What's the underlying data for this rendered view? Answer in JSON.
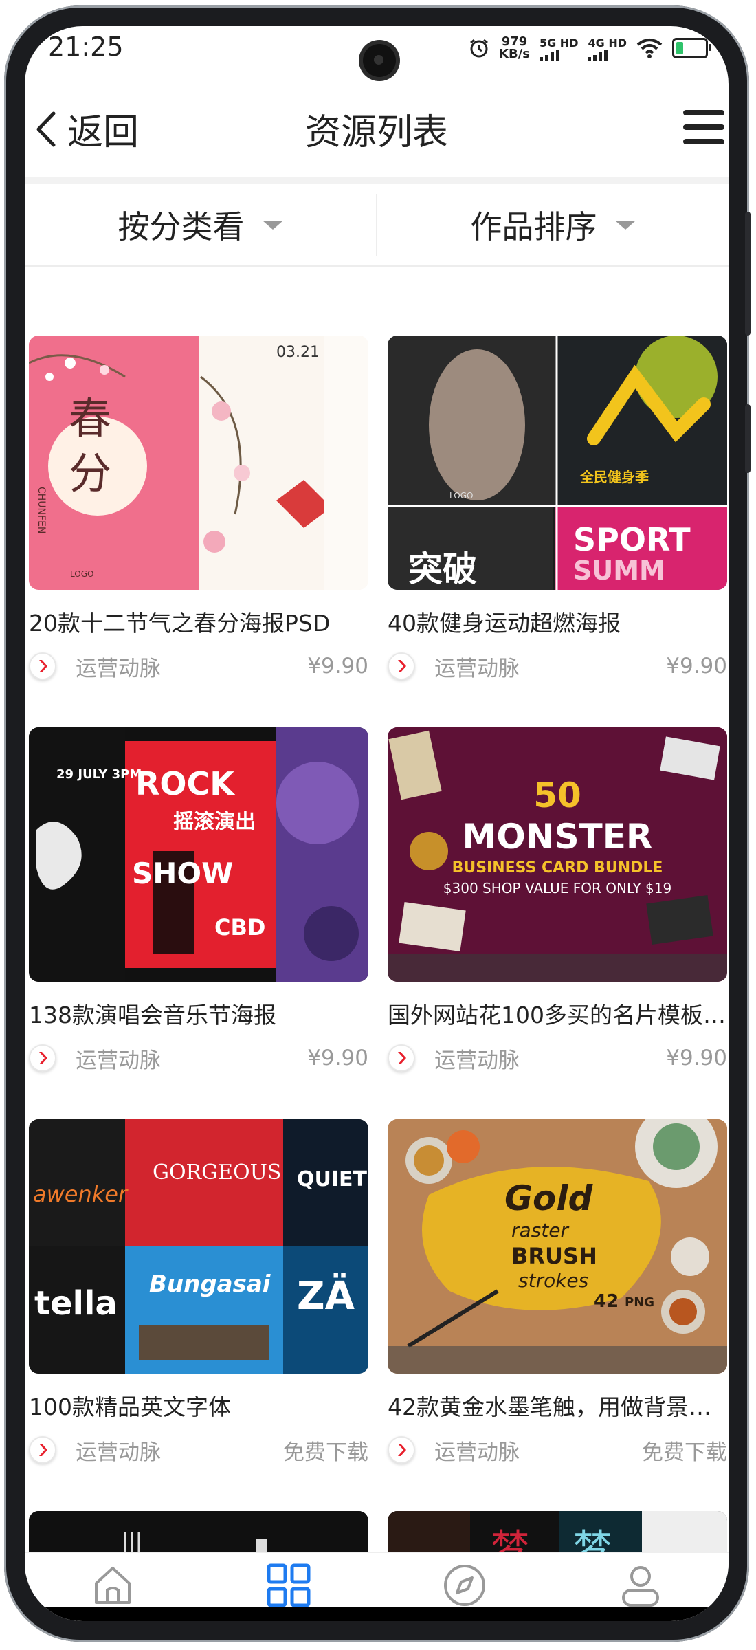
{
  "status_bar": {
    "time": "21:25",
    "speed_value": "979",
    "speed_unit": "KB/s",
    "sim1_label": "5G HD",
    "sim2_label": "4G HD"
  },
  "header": {
    "back_label": "返回",
    "title": "资源列表"
  },
  "filters": {
    "category_label": "按分类看",
    "sort_label": "作品排序"
  },
  "items": [
    {
      "title": "20款十二节气之春分海报PSD",
      "author": "运营动脉",
      "price": "¥9.90"
    },
    {
      "title": "40款健身运动超燃海报",
      "author": "运营动脉",
      "price": "¥9.90"
    },
    {
      "title": "138款演唱会音乐节海报",
      "author": "运营动脉",
      "price": "¥9.90"
    },
    {
      "title": "国外网站花100多买的名片模板…",
      "author": "运营动脉",
      "price": "¥9.90"
    },
    {
      "title": "100款精品英文字体",
      "author": "运营动脉",
      "price": "免费下载"
    },
    {
      "title": "42款黄金水墨笔触，用做背景…",
      "author": "运营动脉",
      "price": "免费下载"
    }
  ],
  "thumb_text": {
    "spring": {
      "big1": "春",
      "big2": "分",
      "sub": "CHUNFEN",
      "date": "03.21",
      "logo": "LOGO"
    },
    "fitness": {
      "word1": "突破",
      "word2": "SPORT",
      "word3": "SUMM",
      "tag": "全民健身季",
      "logo": "LOGO"
    },
    "concert": {
      "line1": "ROCK",
      "line2": "摇滚演出",
      "line3": "SHOW",
      "line4": "CBD",
      "date": "29 JULY 3PM"
    },
    "cards": {
      "num": "50",
      "name": "MONSTER",
      "sub": "BUSINESS CARD BUNDLE",
      "deal": "$300 SHOP VALUE FOR ONLY $19"
    },
    "fonts": {
      "f1": "GORGEOUS",
      "f2": "QUIET",
      "f3": "Bungasai",
      "f4": "tella",
      "f5": "ZÄ",
      "f6": "awenker"
    },
    "gold": {
      "l1": "Gold",
      "l2": "raster",
      "l3": "BRUSH",
      "l4": "strokes",
      "count": "42",
      "fmt": "PNG"
    },
    "row4b": {
      "w1": "梦",
      "w2": "梦"
    }
  },
  "colors": {
    "accent_blue": "#1e7bf0",
    "logo_red": "#e8202d",
    "price_gray": "#999999"
  },
  "tabbar": {
    "icons": [
      "home-icon",
      "grid-icon",
      "compass-icon",
      "profile-icon"
    ],
    "active": "grid-icon"
  }
}
